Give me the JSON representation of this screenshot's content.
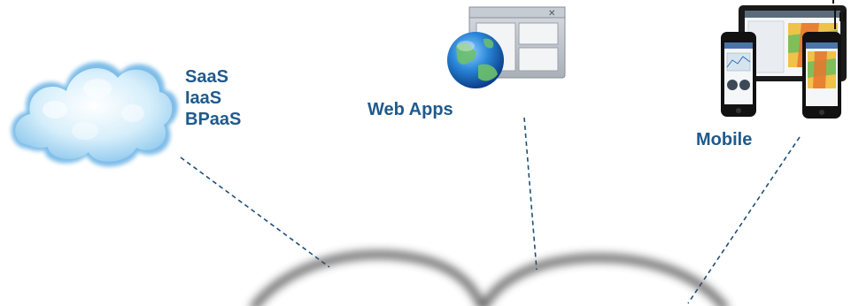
{
  "cloud": {
    "services": [
      "SaaS",
      "IaaS",
      "BPaaS"
    ],
    "icon": "cloud-icon"
  },
  "web_apps": {
    "label": "Web Apps",
    "icon": "globe-browser-window-icon"
  },
  "mobile": {
    "label": "Mobile",
    "icon": "tablet-and-phones-icon"
  },
  "colors": {
    "label_text": "#1f5a8c",
    "dashed_line": "#1f4f7a",
    "cloud_fill": "#bfe3f8",
    "arc_shadow": "#5a5a5a"
  }
}
